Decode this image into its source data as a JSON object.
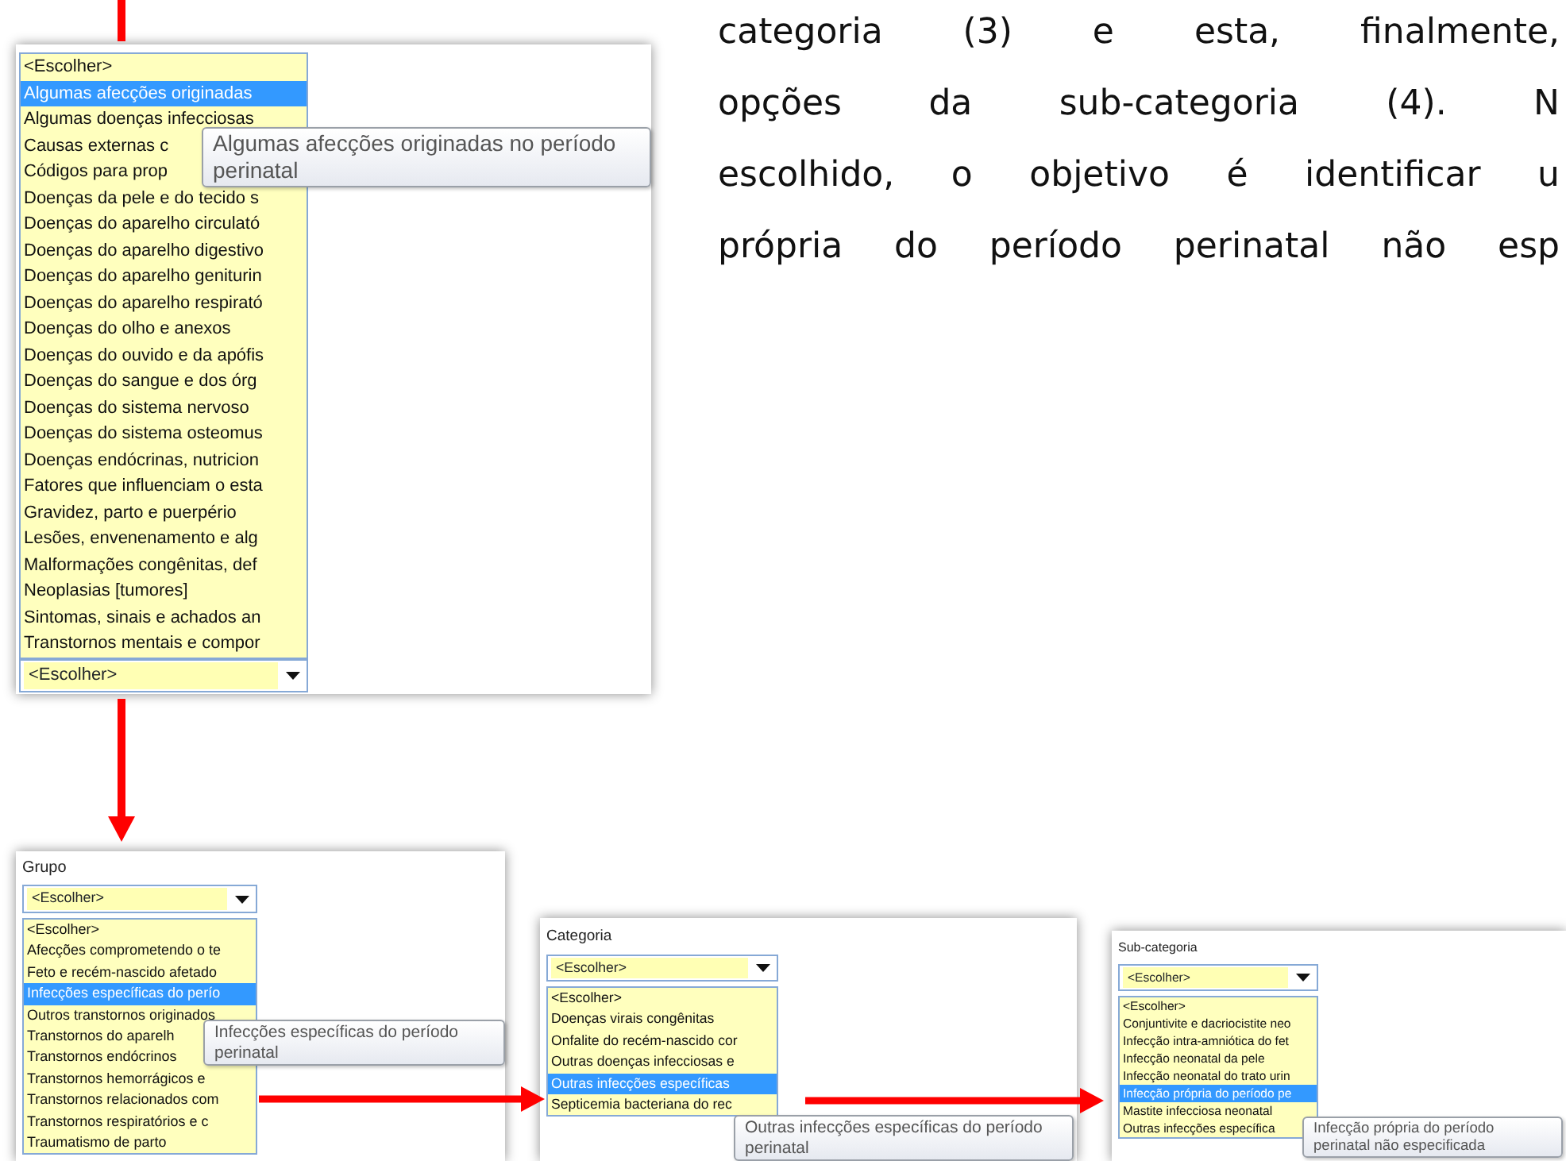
{
  "paragraph": {
    "lines": [
      "categoria (3) e esta, finalmente,",
      "opções da sub-categoria (4). N",
      "escolhido, o objetivo é identificar u",
      "própria do período perinatal não esp"
    ]
  },
  "panels": [
    {
      "kind": "list-above-combo",
      "items": [
        {
          "label": "<Escolher>",
          "selected": false
        },
        {
          "label": "Algumas afecções originadas",
          "selected": true
        },
        {
          "label": "Algumas doenças infecciosas",
          "selected": false
        },
        {
          "label": "Causas externas c",
          "selected": false
        },
        {
          "label": "Códigos para prop",
          "selected": false
        },
        {
          "label": "Doenças da pele e do tecido s",
          "selected": false
        },
        {
          "label": "Doenças do aparelho circulató",
          "selected": false
        },
        {
          "label": "Doenças do aparelho digestivo",
          "selected": false
        },
        {
          "label": "Doenças do aparelho geniturin",
          "selected": false
        },
        {
          "label": "Doenças do aparelho respirató",
          "selected": false
        },
        {
          "label": "Doenças do olho e anexos",
          "selected": false
        },
        {
          "label": "Doenças do ouvido e da apófis",
          "selected": false
        },
        {
          "label": "Doenças do sangue e dos órg",
          "selected": false
        },
        {
          "label": "Doenças do sistema nervoso",
          "selected": false
        },
        {
          "label": "Doenças do sistema osteomus",
          "selected": false
        },
        {
          "label": "Doenças endócrinas, nutricion",
          "selected": false
        },
        {
          "label": "Fatores que influenciam o esta",
          "selected": false
        },
        {
          "label": "Gravidez, parto e puerpério",
          "selected": false
        },
        {
          "label": "Lesões, envenenamento e alg",
          "selected": false
        },
        {
          "label": "Malformações congênitas, def",
          "selected": false
        },
        {
          "label": "Neoplasias [tumores]",
          "selected": false
        },
        {
          "label": "Sintomas, sinais e achados an",
          "selected": false
        },
        {
          "label": "Transtornos mentais e compor",
          "selected": false
        }
      ],
      "dropdown": {
        "value": "<Escolher>"
      },
      "tooltip": "Algumas afecções originadas no período perinatal"
    },
    {
      "kind": "combo-above-list",
      "label": "Grupo",
      "items": [
        {
          "label": "<Escolher>",
          "selected": false
        },
        {
          "label": "Afecções comprometendo o te",
          "selected": false
        },
        {
          "label": "Feto e recém-nascido afetado",
          "selected": false
        },
        {
          "label": "Infecções específicas do perío",
          "selected": true
        },
        {
          "label": "Outros transtornos originados",
          "selected": false
        },
        {
          "label": "Transtornos do aparelh",
          "selected": false
        },
        {
          "label": "Transtornos endócrinos",
          "selected": false
        },
        {
          "label": "Transtornos hemorrágicos e",
          "selected": false
        },
        {
          "label": "Transtornos relacionados com",
          "selected": false
        },
        {
          "label": "Transtornos respiratórios e c",
          "selected": false
        },
        {
          "label": "Traumatismo de parto",
          "selected": false
        }
      ],
      "dropdown": {
        "value": "<Escolher>"
      },
      "tooltip": "Infecções específicas do período perinatal"
    },
    {
      "kind": "combo-above-list",
      "label": "Categoria",
      "items": [
        {
          "label": "<Escolher>",
          "selected": false
        },
        {
          "label": "Doenças virais congênitas",
          "selected": false
        },
        {
          "label": "Onfalite do recém-nascido cor",
          "selected": false
        },
        {
          "label": "Outras doenças infecciosas e",
          "selected": false
        },
        {
          "label": "Outras infecções específicas",
          "selected": true
        },
        {
          "label": "Septicemia bacteriana do rec",
          "selected": false
        }
      ],
      "dropdown": {
        "value": "<Escolher>"
      },
      "tooltip": "Outras infecções específicas do período perinatal"
    },
    {
      "kind": "combo-above-list",
      "label": "Sub-categoria",
      "items": [
        {
          "label": "<Escolher>",
          "selected": false
        },
        {
          "label": "Conjuntivite e dacriocistite neo",
          "selected": false
        },
        {
          "label": "Infecção intra-amniótica do fet",
          "selected": false
        },
        {
          "label": "Infecção neonatal da pele",
          "selected": false
        },
        {
          "label": "Infecção neonatal do trato urin",
          "selected": false
        },
        {
          "label": "Infecção própria do período pe",
          "selected": true
        },
        {
          "label": "Mastite infecciosa neonatal",
          "selected": false
        },
        {
          "label": "Outras infecções específica",
          "selected": false
        }
      ],
      "dropdown": {
        "value": "<Escolher>"
      },
      "tooltip": "Infecção própria do período perinatal não especificada"
    }
  ]
}
